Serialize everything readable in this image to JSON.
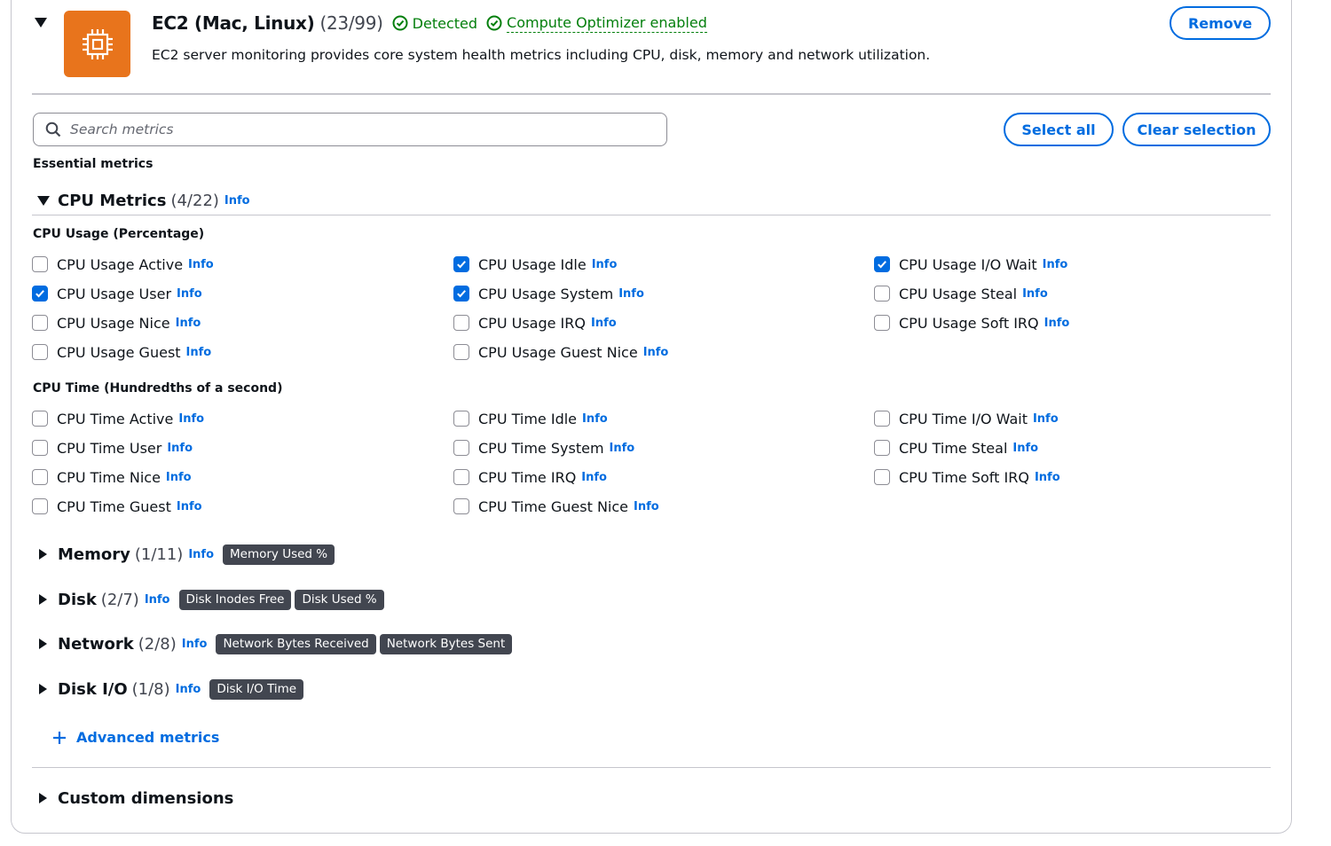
{
  "header": {
    "title": "EC2 (Mac, Linux)",
    "count": "(23/99)",
    "status_detected": "Detected",
    "status_optimizer": "Compute Optimizer enabled",
    "description": "EC2 server monitoring provides core system health metrics including CPU, disk, memory and network utilization.",
    "remove_label": "Remove",
    "logo_icon": "ec2-chip-icon",
    "logo_color": "#e8741c"
  },
  "search": {
    "placeholder": "Search metrics",
    "select_all_label": "Select all",
    "clear_selection_label": "Clear selection"
  },
  "essential_label": "Essential metrics",
  "cpu": {
    "title": "CPU Metrics",
    "count": "(4/22)",
    "info": "Info",
    "usage_group": {
      "label": "CPU Usage (Percentage)",
      "items": [
        {
          "label": "CPU Usage Active",
          "checked": false
        },
        {
          "label": "CPU Usage Idle",
          "checked": true
        },
        {
          "label": "CPU Usage I/O Wait",
          "checked": true
        },
        {
          "label": "CPU Usage User",
          "checked": true
        },
        {
          "label": "CPU Usage System",
          "checked": true
        },
        {
          "label": "CPU Usage Steal",
          "checked": false
        },
        {
          "label": "CPU Usage Nice",
          "checked": false
        },
        {
          "label": "CPU Usage IRQ",
          "checked": false
        },
        {
          "label": "CPU Usage Soft IRQ",
          "checked": false
        },
        {
          "label": "CPU Usage Guest",
          "checked": false
        },
        {
          "label": "CPU Usage Guest Nice",
          "checked": false
        }
      ]
    },
    "time_group": {
      "label": "CPU Time (Hundredths of a second)",
      "items": [
        {
          "label": "CPU Time Active",
          "checked": false
        },
        {
          "label": "CPU Time Idle",
          "checked": false
        },
        {
          "label": "CPU Time I/O Wait",
          "checked": false
        },
        {
          "label": "CPU Time User",
          "checked": false
        },
        {
          "label": "CPU Time System",
          "checked": false
        },
        {
          "label": "CPU Time Steal",
          "checked": false
        },
        {
          "label": "CPU Time Nice",
          "checked": false
        },
        {
          "label": "CPU Time IRQ",
          "checked": false
        },
        {
          "label": "CPU Time Soft IRQ",
          "checked": false
        },
        {
          "label": "CPU Time Guest",
          "checked": false
        },
        {
          "label": "CPU Time Guest Nice",
          "checked": false
        }
      ]
    }
  },
  "sections": [
    {
      "title": "Memory",
      "count": "(1/11)",
      "info": "Info",
      "chips": [
        "Memory Used %"
      ]
    },
    {
      "title": "Disk",
      "count": "(2/7)",
      "info": "Info",
      "chips": [
        "Disk Inodes Free",
        "Disk Used %"
      ]
    },
    {
      "title": "Network",
      "count": "(2/8)",
      "info": "Info",
      "chips": [
        "Network Bytes Received",
        "Network Bytes Sent"
      ]
    },
    {
      "title": "Disk I/O",
      "count": "(1/8)",
      "info": "Info",
      "chips": [
        "Disk I/O Time"
      ]
    }
  ],
  "advanced_label": "Advanced metrics",
  "custom_dimensions_label": "Custom dimensions",
  "colors": {
    "accent": "#006ce0",
    "success": "#037f0c",
    "chip_bg": "#424650"
  }
}
